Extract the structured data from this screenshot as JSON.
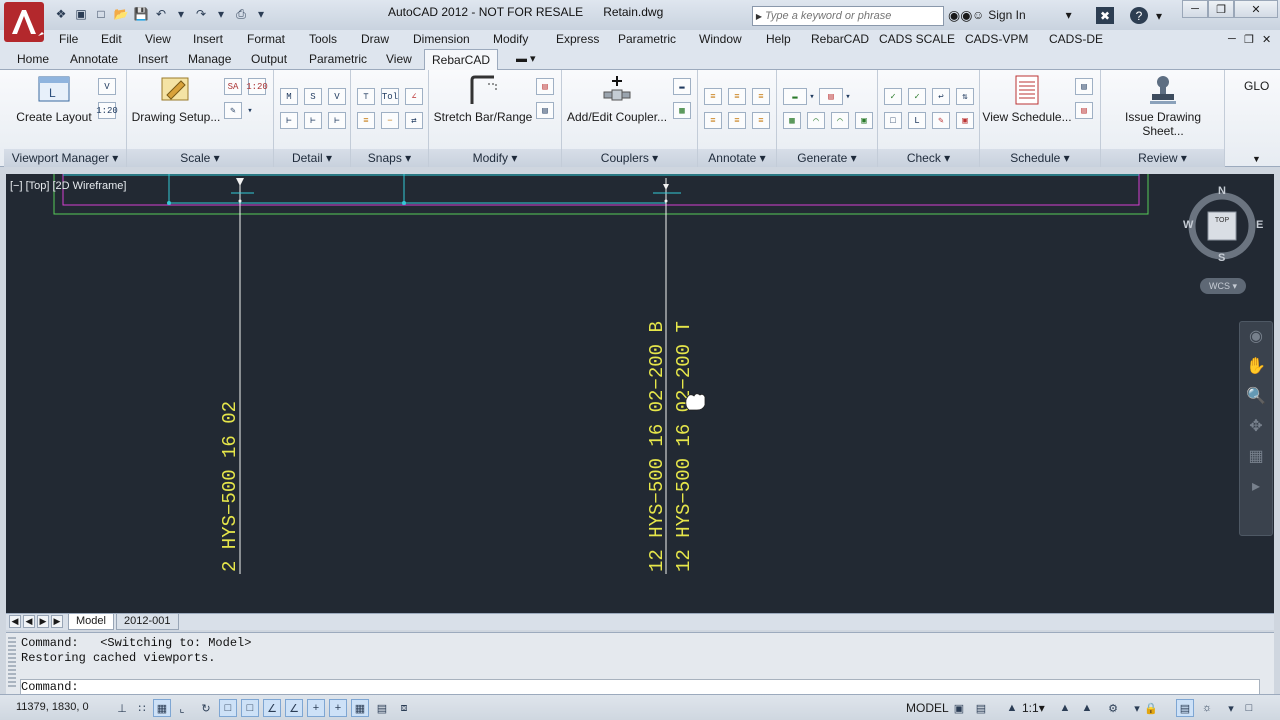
{
  "title": {
    "product": "AutoCAD 2012 - NOT FOR RESALE",
    "file": "Retain.dwg",
    "search_placeholder": "Type a keyword or phrase",
    "sign_in": "Sign In"
  },
  "menu": [
    "File",
    "Edit",
    "View",
    "Insert",
    "Format",
    "Tools",
    "Draw",
    "Dimension",
    "Modify",
    "Express",
    "Parametric",
    "Window",
    "Help",
    "RebarCAD",
    "CADS SCALE",
    "CADS-VPM",
    "CADS-DE"
  ],
  "tabs": [
    "Home",
    "Annotate",
    "Insert",
    "Manage",
    "Output",
    "Parametric",
    "View",
    "RebarCAD"
  ],
  "active_tab": "RebarCAD",
  "ribbon": {
    "buttons": {
      "create_layout": "Create Layout",
      "drawing_setup": "Drawing Setup...",
      "stretch_bar": "Stretch Bar/Range",
      "add_coupler": "Add/Edit Coupler...",
      "view_schedule": "View Schedule...",
      "issue_sheet": "Issue Drawing Sheet..."
    },
    "small_labels": {
      "v": "V",
      "s120a": "1:20",
      "sa": "SA",
      "s120b": "1:20",
      "m": "M",
      "s": "S",
      "vv": "V",
      "tol": "Tol",
      "l": "L"
    },
    "panels": [
      "Viewport Manager",
      "Scale",
      "Detail",
      "Snaps",
      "Modify",
      "Couplers",
      "Annotate",
      "Generate",
      "Check",
      "Schedule",
      "Review"
    ],
    "overflow": "GLO"
  },
  "viewport": {
    "label": "[−] [Top] [2D Wireframe]",
    "bar_label_left": "2 HYS−500 16 02",
    "bar_label_b": "12 HYS−500 16 02−200 B",
    "bar_label_t": "12 HYS−500 16 02−200 T",
    "viewcube": {
      "n": "N",
      "s": "S",
      "e": "E",
      "w": "W",
      "face": "TOP"
    },
    "wcs": "WCS"
  },
  "layout_tabs": [
    "Model",
    "2012-001"
  ],
  "active_layout": "Model",
  "command": {
    "history": [
      "Command:   <Switching to: Model>",
      "Restoring cached viewports."
    ],
    "prompt": "Command:"
  },
  "status": {
    "coords": "11379, 1830, 0",
    "model": "MODEL",
    "scale": "1:1"
  },
  "colors": {
    "canvas": "#222933",
    "rebar_text": "#e6e64a",
    "bar_line": "#f2f2f2",
    "outline_cyan": "#33c9d6",
    "outline_magenta": "#d43fd0",
    "outline_green": "#57cc57"
  }
}
